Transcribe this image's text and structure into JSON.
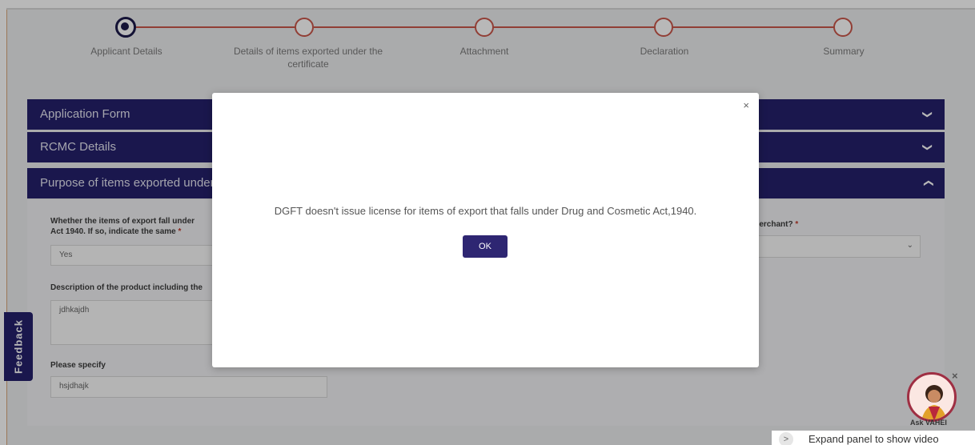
{
  "stepper": {
    "steps": [
      {
        "label": "Applicant Details",
        "active": true
      },
      {
        "label": "Details of items exported under the certificate",
        "active": false
      },
      {
        "label": "Attachment",
        "active": false
      },
      {
        "label": "Declaration",
        "active": false
      },
      {
        "label": "Summary",
        "active": false
      }
    ]
  },
  "accordion": {
    "application_form": "Application Form",
    "rcmc_details": "RCMC Details",
    "purpose": "Purpose of items exported under"
  },
  "form": {
    "drug_question_line1": "Whether the items of export fall under",
    "drug_question_line2": "Act 1940. If so, indicate the same",
    "drug_value": "Yes",
    "merchant_question": "Merchant?",
    "description_label": "Description of the product including the",
    "description_value": "jdhkajdh",
    "specify_label": "Please specify",
    "specify_value": "hsjdhajk",
    "required_mark": "*"
  },
  "feedback_label": "Feedback",
  "modal": {
    "message": "DGFT doesn't issue license for items of export that falls under Drug and Cosmetic Act,1940.",
    "ok_label": "OK",
    "close_glyph": "×"
  },
  "assistant": {
    "label": "Ask VAHEI",
    "close_glyph": "×",
    "expand_text": "Expand panel to show video",
    "expand_glyph": ">"
  },
  "colors": {
    "brand_navy": "#24206b",
    "stepper_line": "#c9574a",
    "ok_button": "#2e2672"
  }
}
